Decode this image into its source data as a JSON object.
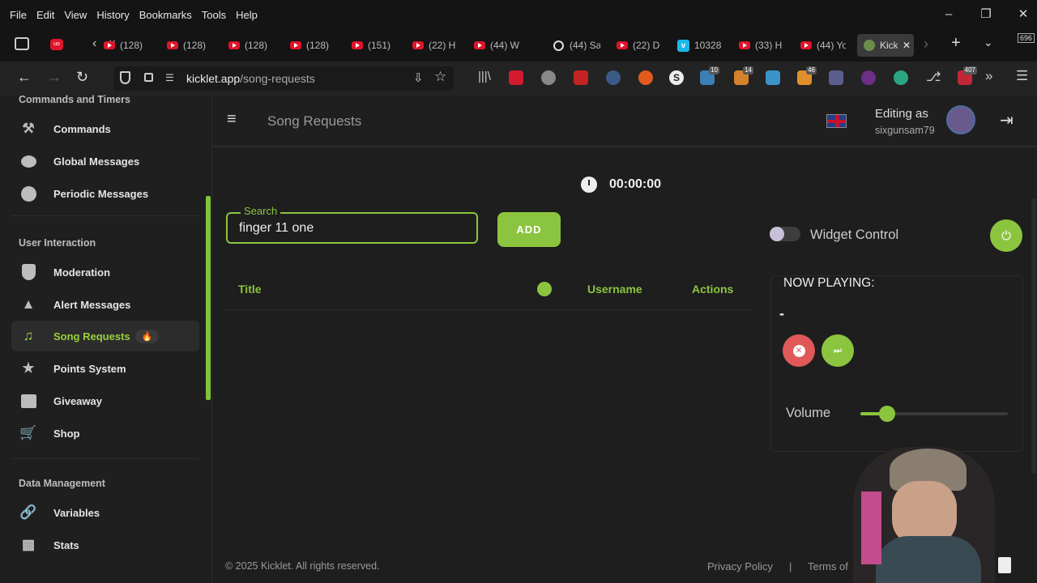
{
  "menubar": {
    "items": [
      "File",
      "Edit",
      "View",
      "History",
      "Bookmarks",
      "Tools",
      "Help"
    ]
  },
  "tabs": [
    {
      "label": "(128)",
      "icon": "youtube-icon"
    },
    {
      "label": "(128)",
      "icon": "youtube-icon"
    },
    {
      "label": "(128)",
      "icon": "youtube-icon"
    },
    {
      "label": "(128)",
      "icon": "youtube-icon"
    },
    {
      "label": "(151)",
      "icon": "youtube-icon"
    },
    {
      "label": "(22) H",
      "icon": "youtube-icon"
    },
    {
      "label": "(44) W",
      "icon": "youtube-icon"
    },
    {
      "label": "(44) Sa",
      "icon": "play-circle-icon"
    },
    {
      "label": "(22) D",
      "icon": "youtube-icon"
    },
    {
      "label": "10328",
      "icon": "vimeo-icon"
    },
    {
      "label": "(33) H",
      "icon": "youtube-icon"
    },
    {
      "label": "(44) Yo",
      "icon": "youtube-icon"
    },
    {
      "label": "Kick",
      "icon": "kicklet-icon"
    }
  ],
  "tab_counter": "696",
  "address": {
    "domain": "kicklet.app",
    "path": "/song-requests"
  },
  "extension_badges": [
    "10",
    "14",
    "46",
    "407"
  ],
  "sidebar": {
    "section1": {
      "title": "Commands and Timers"
    },
    "items1": [
      {
        "label": "Commands",
        "icon": "hammer-icon"
      },
      {
        "label": "Global Messages",
        "icon": "chat-bubble-icon"
      },
      {
        "label": "Periodic Messages",
        "icon": "clock-icon"
      }
    ],
    "section2": {
      "title": "User Interaction"
    },
    "items2": [
      {
        "label": "Moderation",
        "icon": "shield-icon"
      },
      {
        "label": "Alert Messages",
        "icon": "warning-icon"
      },
      {
        "label": "Song Requests",
        "icon": "music-note-icon",
        "active": true,
        "badge": "🔥"
      },
      {
        "label": "Points System",
        "icon": "star-icon"
      },
      {
        "label": "Giveaway",
        "icon": "gift-icon"
      },
      {
        "label": "Shop",
        "icon": "cart-icon"
      }
    ],
    "section3": {
      "title": "Data Management"
    },
    "items3": [
      {
        "label": "Variables",
        "icon": "link-icon"
      },
      {
        "label": "Stats",
        "icon": "bar-chart-icon"
      }
    ]
  },
  "header": {
    "title": "Song Requests",
    "editing_label": "Editing as",
    "username": "sixgunsam79"
  },
  "main": {
    "timer": "00:00:00",
    "search": {
      "label": "Search",
      "value": "finger 11 one"
    },
    "add_button": "ADD",
    "table": {
      "title": "Title",
      "username": "Username",
      "actions": "Actions"
    },
    "widget_control": "Widget Control",
    "now_playing": {
      "label": "NOW PLAYING:",
      "track": "-"
    },
    "volume": {
      "label": "Volume",
      "level": 0.18
    }
  },
  "footer": {
    "copyright": "© 2025 Kicklet. All rights reserved.",
    "privacy": "Privacy Policy",
    "divider": "|",
    "terms": "Terms of"
  },
  "colors": {
    "accent": "#8bc53f",
    "danger": "#e05858",
    "bg": "#1e1e1e"
  }
}
